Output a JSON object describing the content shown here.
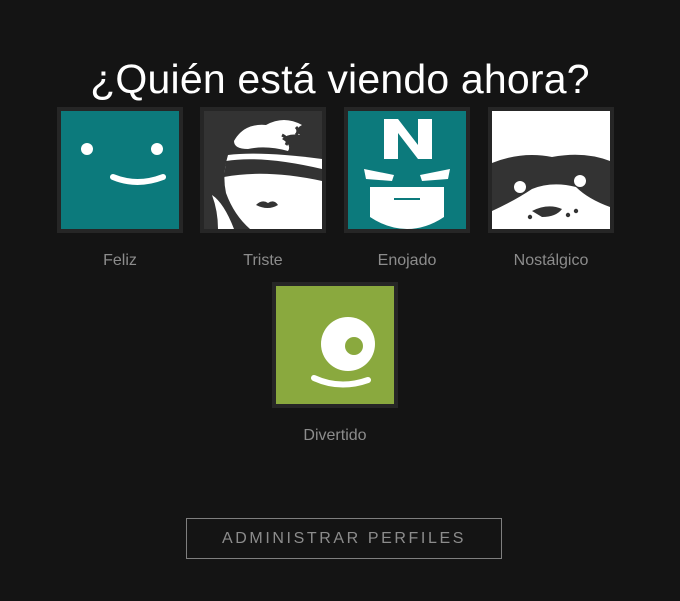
{
  "page": {
    "title": "¿Quién está viendo ahora?"
  },
  "profiles": [
    {
      "name": "Feliz",
      "icon": "smile-face-icon",
      "color": "#0c7a7c"
    },
    {
      "name": "Triste",
      "icon": "sad-face-icon",
      "color": "#333333"
    },
    {
      "name": "Enojado",
      "icon": "angry-face-icon",
      "color": "#0c7a7c"
    },
    {
      "name": "Nostálgico",
      "icon": "masked-face-icon",
      "color": "#ffffff"
    },
    {
      "name": "Divertido",
      "icon": "winking-face-icon",
      "color": "#8aa93e"
    }
  ],
  "actions": {
    "manage_profiles_label": "ADMINISTRAR PERFILES"
  },
  "colors": {
    "background": "#141414",
    "frame": "#262626",
    "label": "#8c8c8c"
  }
}
